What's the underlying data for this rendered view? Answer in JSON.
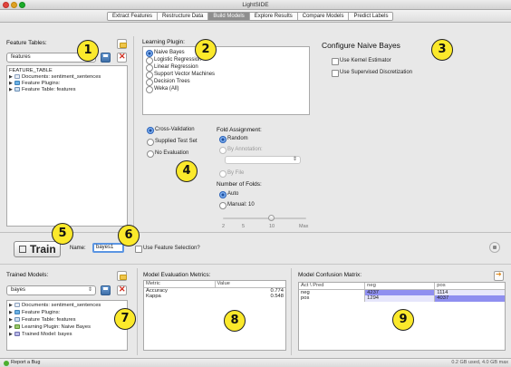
{
  "window": {
    "title": "LightSIDE"
  },
  "tabs": [
    {
      "label": "Extract Features",
      "active": false
    },
    {
      "label": "Restructure Data",
      "active": false
    },
    {
      "label": "Build Models",
      "active": true
    },
    {
      "label": "Explore Results",
      "active": false
    },
    {
      "label": "Compare Models",
      "active": false
    },
    {
      "label": "Predict Labels",
      "active": false
    }
  ],
  "feature_tables": {
    "label": "Feature Tables:",
    "selected": "features",
    "tree": {
      "root": "FEATURE_TABLE",
      "items": [
        {
          "label": "Documents: sentiment_sentences",
          "icon": "document-icon"
        },
        {
          "label": "Feature Plugins:",
          "icon": "plugin-icon"
        },
        {
          "label": "Feature Table: features",
          "icon": "table-icon"
        }
      ]
    }
  },
  "learning_plugin": {
    "label": "Learning Plugin:",
    "options": [
      "Naive Bayes",
      "Logistic Regression",
      "Linear Regression",
      "Support Vector Machines",
      "Decision Trees",
      "Weka (All)"
    ],
    "selected": "Naive Bayes"
  },
  "configure": {
    "title": "Configure Naive Bayes",
    "options": [
      {
        "label": "Use Kernel Estimator",
        "checked": false
      },
      {
        "label": "Use Supervised Discretization",
        "checked": false
      }
    ]
  },
  "evaluation": {
    "options": [
      "Cross-Validation",
      "Supplied Test Set",
      "No Evaluation"
    ],
    "selected": "Cross-Validation"
  },
  "fold_assignment": {
    "label": "Fold Assignment:",
    "options": [
      "Random",
      "By Annotation:",
      "By File"
    ],
    "selected": "Random",
    "folds_label": "Number of Folds:",
    "folds_options": [
      "Auto",
      "Manual: 10"
    ],
    "folds_selected": "Auto",
    "slider_ticks": [
      "2",
      "5",
      "10",
      "Max"
    ],
    "slider_value": 10
  },
  "train": {
    "button_label": "Train",
    "name_label": "Name:",
    "name_value": "bayes1",
    "feature_selection_label": "Use Feature Selection?"
  },
  "trained_models": {
    "label": "Trained Models:",
    "selected": "bayes",
    "tree": [
      {
        "label": "Documents: sentiment_sentences",
        "icon": "document-icon"
      },
      {
        "label": "Feature Plugins:",
        "icon": "plugin-icon"
      },
      {
        "label": "Feature Table: features",
        "icon": "table-icon"
      },
      {
        "label": "Learning Plugin:  Naive Bayes",
        "icon": "learning-icon"
      },
      {
        "label": "Trained Model: bayes",
        "icon": "model-icon"
      }
    ]
  },
  "metrics": {
    "label": "Model Evaluation Metrics:",
    "headers": [
      "Metric",
      "Value"
    ],
    "rows": [
      {
        "metric": "Accuracy",
        "value": "0.774"
      },
      {
        "metric": "Kappa",
        "value": "0.548"
      }
    ]
  },
  "confusion": {
    "label": "Model Confusion Matrix:",
    "headers": [
      "Act \\ Pred",
      "neg",
      "pos"
    ],
    "rows": [
      {
        "actual": "neg",
        "neg": "4237",
        "pos": "1114"
      },
      {
        "actual": "pos",
        "neg": "1294",
        "pos": "4037"
      }
    ],
    "highlight_color": "#8f8ff0"
  },
  "status": {
    "left": "Report a Bug",
    "right": "0.2 GB used, 4.0 GB max"
  },
  "callouts": [
    "1",
    "2",
    "3",
    "4",
    "5",
    "6",
    "7",
    "8",
    "9"
  ],
  "colors": {
    "callout": "#fbe92b",
    "accent": "#5b95e2"
  }
}
